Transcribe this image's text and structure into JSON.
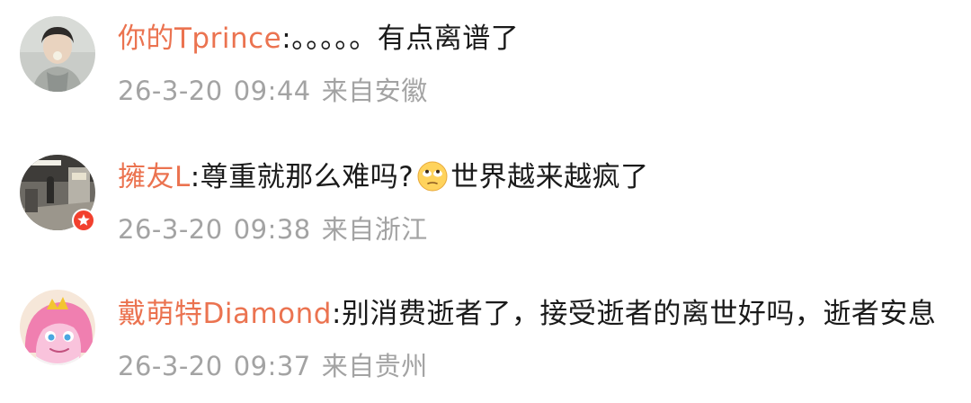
{
  "comments": [
    {
      "username": "你的Tprince",
      "separator": ":",
      "text": "。。。。。有点离谱了",
      "text_after_emoji": "",
      "date": "26-3-20",
      "time": "09:44",
      "location": "来自安徽",
      "avatar_icon": "avatar-photo-person-icon"
    },
    {
      "username": "擁友L",
      "separator": ":",
      "text": "尊重就那么难吗?",
      "emoji_icon": "eye-roll-emoji-icon",
      "text_after_emoji": "世界越来越疯了",
      "date": "26-3-20",
      "time": "09:38",
      "location": "来自浙江",
      "avatar_icon": "avatar-photo-station-icon",
      "badge_icon": "verified-badge-icon",
      "badge_color": "#f2402e"
    },
    {
      "username": "戴萌特Diamond",
      "separator": ":",
      "text": "别消费逝者了，接受逝者的离世好吗，逝者安息",
      "text_after_emoji": "",
      "date": "26-3-20",
      "time": "09:37",
      "location": "来自贵州",
      "avatar_icon": "avatar-pony-icon"
    }
  ],
  "colors": {
    "username": "#eb7350",
    "text": "#1a1a1a",
    "meta": "#a3a3a3"
  }
}
